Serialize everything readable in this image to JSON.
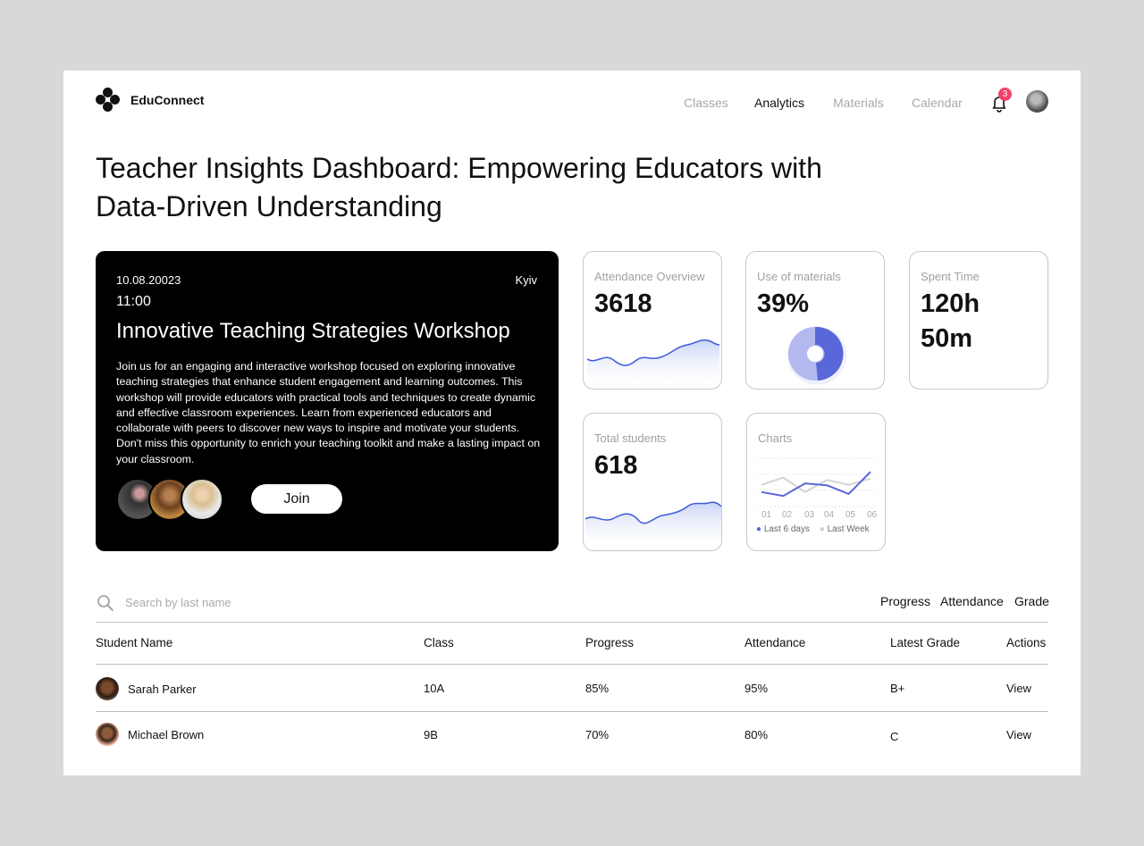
{
  "header": {
    "brand": "EduConnect",
    "nav": [
      "Classes",
      "Analytics",
      "Materials",
      "Calendar"
    ],
    "active_nav": "Analytics",
    "notification_count": "3"
  },
  "page_title": "Teacher Insights Dashboard: Empowering Educators with Data-Driven Understanding",
  "event": {
    "date": "10.08.20023",
    "time": "11:00",
    "city": "Kyiv",
    "title": "Innovative Teaching Strategies Workshop",
    "description": "Join us for an engaging and interactive workshop focused on exploring innovative teaching strategies that enhance student engagement and learning outcomes. This workshop will provide educators with practical tools and techniques to create dynamic and effective classroom experiences. Learn from experienced educators and collaborate with peers to discover new ways to inspire and motivate your students. Don't miss this opportunity to enrich your teaching toolkit and make a lasting impact on your classroom.",
    "join_label": "Join"
  },
  "stats": {
    "attendance": {
      "label": "Attendance Overview",
      "value": "3618"
    },
    "materials": {
      "label": "Use of materials",
      "value": "39%"
    },
    "spent_time": {
      "label": "Spent Time",
      "value_hours": "120h",
      "value_minutes": "50m"
    },
    "students": {
      "label": "Total students",
      "value": "618"
    },
    "charts": {
      "label": "Charts",
      "x_labels": [
        "01",
        "02",
        "03",
        "04",
        "05",
        "06"
      ],
      "legend": [
        "Last 6 days",
        "Last Week"
      ]
    }
  },
  "colors": {
    "accent": "#5a67d8",
    "accent_light": "#b3b9ee",
    "badge": "#f0436b"
  },
  "chart_data": {
    "type": "line",
    "title": "Charts",
    "x": [
      "01",
      "02",
      "03",
      "04",
      "05",
      "06"
    ],
    "series": [
      {
        "name": "Last 6 days",
        "values": [
          30,
          22,
          48,
          44,
          26,
          72
        ]
      },
      {
        "name": "Last Week",
        "values": [
          45,
          60,
          30,
          55,
          45,
          58
        ]
      }
    ],
    "ylim": [
      0,
      100
    ],
    "grid": true
  },
  "table": {
    "search_placeholder": "Search by last name",
    "filters": [
      "Progress",
      "Attendance",
      "Grade"
    ],
    "columns": [
      "Student Name",
      "Class",
      "Progress",
      "Attendance",
      "Latest Grade",
      "Actions"
    ],
    "rows": [
      {
        "name": "Sarah Parker",
        "class": "10A",
        "progress": "85%",
        "attendance": "95%",
        "grade": "B+",
        "action": "View"
      },
      {
        "name": "Michael Brown",
        "class": "9B",
        "progress": "70%",
        "attendance": "80%",
        "grade": "C",
        "action": "View"
      }
    ]
  }
}
